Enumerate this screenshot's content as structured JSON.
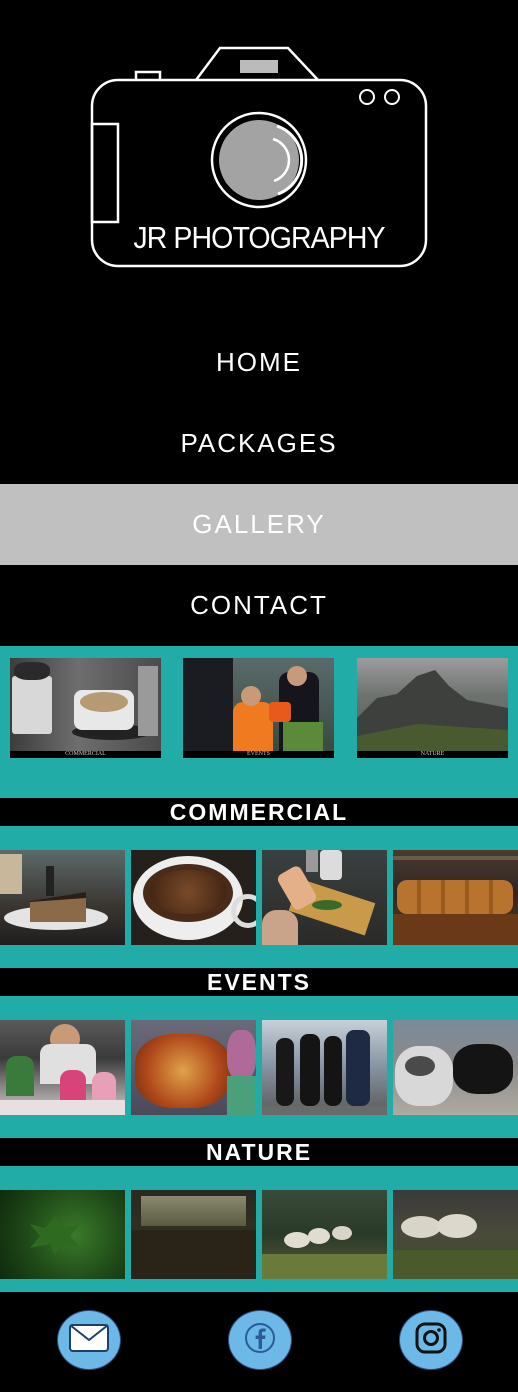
{
  "brand": {
    "logo_text": "JR PHOTOGRAPHY"
  },
  "nav": [
    {
      "label": "HOME"
    },
    {
      "label": "PACKAGES"
    },
    {
      "label": "GALLERY",
      "active": true
    },
    {
      "label": "CONTACT"
    }
  ],
  "categories": [
    {
      "caption": "COMMERCIAL"
    },
    {
      "caption": "EVENTS"
    },
    {
      "caption": "NATURE"
    }
  ],
  "sections": [
    {
      "title": "COMMERCIAL"
    },
    {
      "title": "EVENTS"
    },
    {
      "title": "NATURE"
    }
  ],
  "colors": {
    "teal": "#21aca7",
    "nav_active": "#c0c0c0",
    "social": "#6cb8e6"
  },
  "social": [
    "mail-icon",
    "facebook-icon",
    "instagram-icon"
  ]
}
